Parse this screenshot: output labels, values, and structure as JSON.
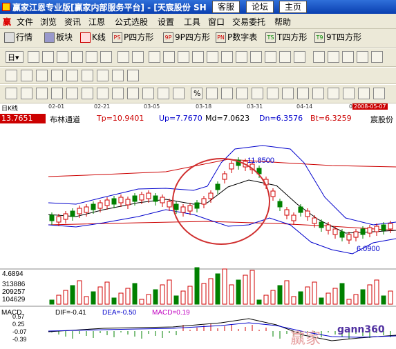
{
  "window": {
    "title": "赢家江恩专业版[赢家内部服务平台] - [天宸股份 SH",
    "buttons": [
      "客服",
      "论坛",
      "主页"
    ]
  },
  "menu": [
    "文件",
    "浏览",
    "资讯",
    "江恩",
    "公式选股",
    "设置",
    "工具",
    "窗口",
    "交易委托",
    "帮助"
  ],
  "toolbar1": {
    "items": [
      "行情",
      "板块",
      "K线",
      "P四方形",
      "9P四方形",
      "P数字表",
      "T四方形",
      "9T四方形"
    ],
    "icon_labels": [
      "PS",
      "9P",
      "PN",
      "TS",
      "T9"
    ]
  },
  "datebar": {
    "left_label": "日K线",
    "dates": [
      "02-01",
      "02-21",
      "03-05",
      "03-18",
      "03-31",
      "04-14",
      "04"
    ],
    "current_date": "2008-05-07"
  },
  "indicator": {
    "price": "13.7651",
    "name": "布林通道",
    "tp": "Tp=10.9401",
    "up": "Up=7.7670",
    "md": "Md=7.0623",
    "dn": "Dn=6.3576",
    "bt": "Bt=6.3259",
    "stock": "宸股份"
  },
  "chart_data": {
    "type": "candlestick",
    "price_marks": {
      "high_label": "11.8500",
      "low_label": "6.0900"
    },
    "volume_axis": [
      "4.6894",
      "313886",
      "209257",
      "104629"
    ],
    "macd": {
      "title": "MACD",
      "dif": "DIF=-0.41",
      "dea": "DEA=-0.50",
      "macd": "MACD=0.19",
      "axis": [
        "0.57",
        "0.25",
        "-0.07",
        "-0.39"
      ]
    },
    "colors": {
      "up": "#d00000",
      "down": "#008000",
      "upper_band": "#0000cc",
      "mid_band": "#000000",
      "lower_band": "#0000cc",
      "ma_red": "#c00000"
    }
  },
  "watermark": {
    "text": "gann360",
    "sub": "赢家"
  }
}
